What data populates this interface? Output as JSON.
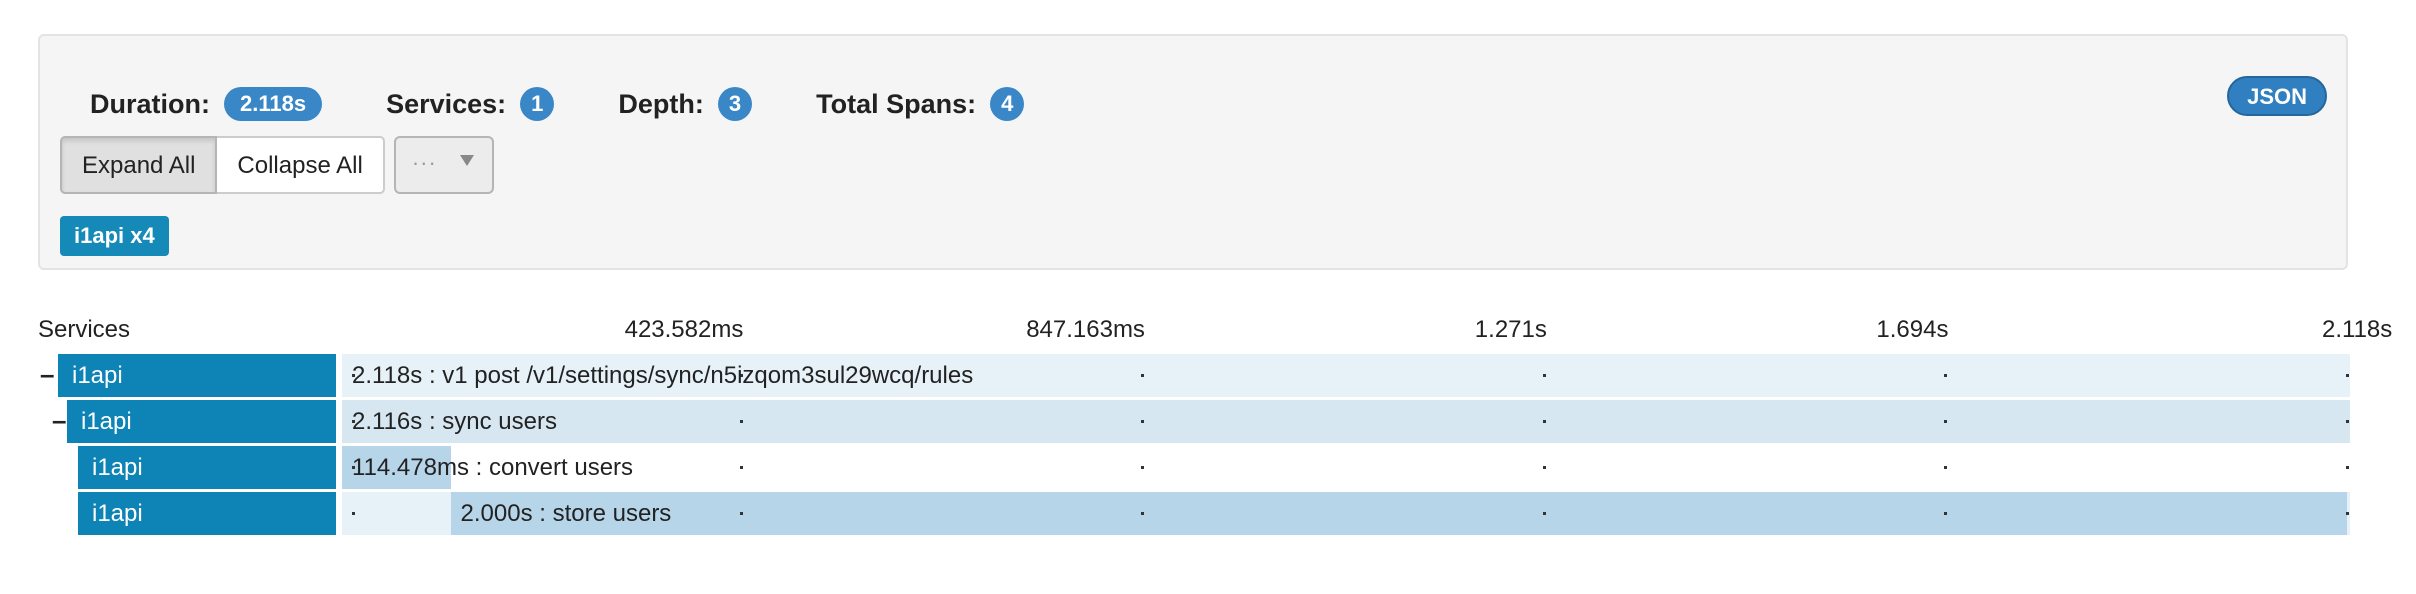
{
  "summary": {
    "duration_label": "Duration:",
    "duration_value": "2.118s",
    "services_label": "Services:",
    "services_value": "1",
    "depth_label": "Depth:",
    "depth_value": "3",
    "spans_label": "Total Spans:",
    "spans_value": "4",
    "json_button": "JSON"
  },
  "controls": {
    "expand_all": "Expand All",
    "collapse_all": "Collapse All",
    "more_options": "···"
  },
  "service_filter": {
    "tag": "i1api x4"
  },
  "timeline": {
    "services_header": "Services",
    "ticks": [
      "423.582ms",
      "847.163ms",
      "1.271s",
      "1.694s",
      "2.118s"
    ],
    "total_ms": 2118
  },
  "colors": {
    "service_blue": "#0e83b5",
    "bar_light": "#b7d5e9",
    "row_light": "#e7f1f8",
    "row_alt": "#d6e7f2",
    "badge_blue": "#3a87c8"
  },
  "spans": [
    {
      "service": "i1api",
      "toggle": "–",
      "label": "2.118s : v1 post /v1/settings/sync/n5izqom3sul29wcq/rules",
      "depth": 0,
      "start_ms": 0,
      "duration_ms": 2118
    },
    {
      "service": "i1api",
      "toggle": "–",
      "label": "2.116s : sync users",
      "depth": 1,
      "start_ms": 0,
      "duration_ms": 2116
    },
    {
      "service": "i1api",
      "toggle": "",
      "label": "114.478ms : convert users",
      "depth": 2,
      "start_ms": 0,
      "duration_ms": 114.478
    },
    {
      "service": "i1api",
      "toggle": "",
      "label": "2.000s : store users",
      "depth": 2,
      "start_ms": 114.478,
      "duration_ms": 2000
    }
  ]
}
